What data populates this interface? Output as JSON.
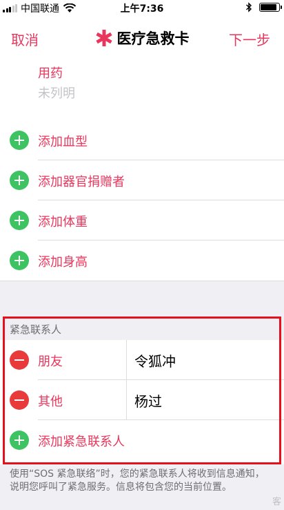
{
  "status_bar": {
    "carrier": "中国联通",
    "time": "上午7:36",
    "battery_level": 0.9
  },
  "nav": {
    "cancel": "取消",
    "title": "医疗急救卡",
    "next": "下一步",
    "accent_color": "#e8365c"
  },
  "medications": {
    "label": "用药",
    "value": "未列明"
  },
  "add_items": [
    {
      "label": "添加血型",
      "icon": "plus-circle-icon"
    },
    {
      "label": "添加器官捐赠者",
      "icon": "plus-circle-icon"
    },
    {
      "label": "添加体重",
      "icon": "plus-circle-icon"
    },
    {
      "label": "添加身高",
      "icon": "plus-circle-icon"
    }
  ],
  "emergency_contacts": {
    "header": "紧急联系人",
    "contacts": [
      {
        "relation": "朋友",
        "name": "令狐冲",
        "icon": "minus-circle-icon"
      },
      {
        "relation": "其他",
        "name": "杨过",
        "icon": "minus-circle-icon"
      }
    ],
    "add_label": "添加紧急联系人",
    "highlight_color": "#e4111d"
  },
  "footer": {
    "text": "使用“SOS 紧急联络”时，您的紧急联系人将收到信息通知，说明您呼叫了紧急服务。信息将包含您的当前位置。",
    "watermark": "客"
  }
}
